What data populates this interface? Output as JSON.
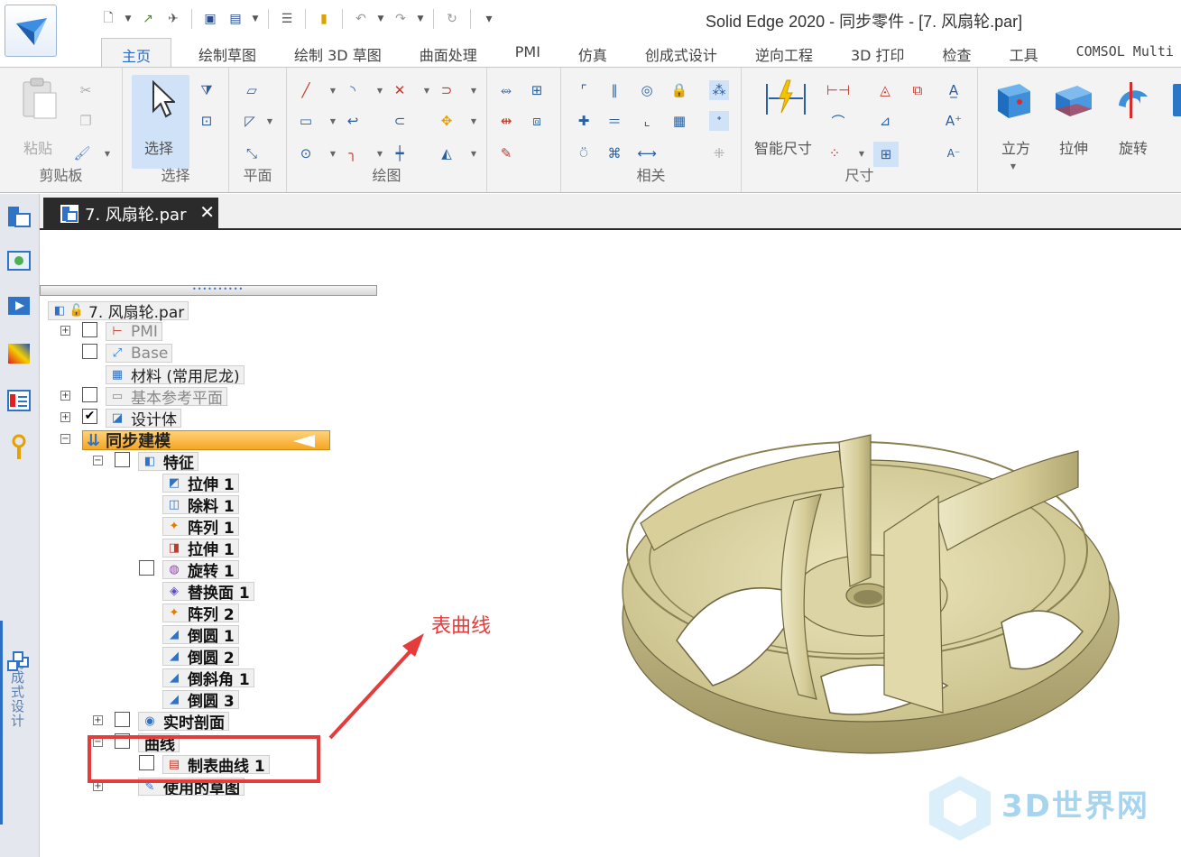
{
  "title_bar": {
    "window_title": "Solid Edge 2020 - 同步零件 - [7. 风扇轮.par]"
  },
  "quick_access": [
    "new-icon",
    "open-icon",
    "send-icon",
    "save-icon",
    "save-as-icon",
    "properties-icon",
    "notes-icon",
    "undo-icon",
    "redo-icon",
    "customize-icon"
  ],
  "menu_tabs": [
    {
      "label": "主页",
      "active": true
    },
    {
      "label": "绘制草图"
    },
    {
      "label": "绘制 3D 草图"
    },
    {
      "label": "曲面处理"
    },
    {
      "label": "PMI"
    },
    {
      "label": "仿真"
    },
    {
      "label": "创成式设计"
    },
    {
      "label": "逆向工程"
    },
    {
      "label": "3D 打印"
    },
    {
      "label": "检查"
    },
    {
      "label": "工具"
    },
    {
      "label": "COMSOL Multi"
    }
  ],
  "ribbon": {
    "groups": {
      "clipboard": "剪贴板",
      "select": "选择",
      "plane": "平面",
      "draw": "绘图",
      "relate": "相关",
      "dimension": "尺寸"
    },
    "buttons": {
      "paste": "粘贴",
      "select": "选择",
      "smart_dimension": "智能尺寸",
      "cube": "立方",
      "extrude": "拉伸",
      "revolve": "旋转"
    }
  },
  "document_tab": {
    "title": "7. 风扇轮.par"
  },
  "tree": {
    "root": "7. 风扇轮.par",
    "items": {
      "pmi": "PMI",
      "base": "Base",
      "material": "材料 (常用尼龙)",
      "base_planes": "基本参考平面",
      "design_body": "设计体",
      "sync_modeling": "同步建模",
      "features": "特征",
      "extrude1": "拉伸 1",
      "cutout1": "除料 1",
      "pattern1": "阵列 1",
      "extrude1b": "拉伸 1",
      "revolve1": "旋转 1",
      "replace_face1": "替换面 1",
      "pattern2": "阵列 2",
      "round1": "倒圆 1",
      "round2": "倒圆 2",
      "chamfer1": "倒斜角 1",
      "round3": "倒圆 3",
      "live_section": "实时剖面",
      "curves": "曲线",
      "table_curve1": "制表曲线 1",
      "used_sketches": "使用的草图"
    }
  },
  "sidebar": {
    "vertical_label": "创成式设计"
  },
  "annotation": {
    "label": "表曲线",
    "color": "#e53b3b"
  },
  "watermark": {
    "text": "3D世界网"
  },
  "colors": {
    "accent": "#2a6bc4",
    "sync_highlight": "#f5a623",
    "model": "#d6cf9e"
  }
}
